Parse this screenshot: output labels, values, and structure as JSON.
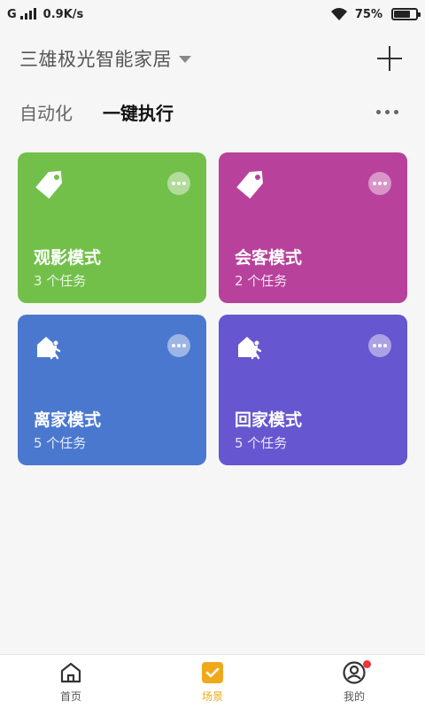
{
  "status_bar": {
    "network_type": "G",
    "speed": "0.9K/s",
    "battery": "75%",
    "battery_level": 0.75
  },
  "header": {
    "home_name": "三雄极光智能家居"
  },
  "tabs": [
    {
      "label": "自动化",
      "active": false
    },
    {
      "label": "一键执行",
      "active": true
    }
  ],
  "scenes": [
    {
      "title": "观影模式",
      "subtitle": "3 个任务",
      "color": "#72c04a",
      "icon": "tag-icon"
    },
    {
      "title": "会客模式",
      "subtitle": "2 个任务",
      "color": "#b8419c",
      "icon": "tag-icon"
    },
    {
      "title": "离家模式",
      "subtitle": "5 个任务",
      "color": "#4a78cf",
      "icon": "leave-home-icon"
    },
    {
      "title": "回家模式",
      "subtitle": "5 个任务",
      "color": "#6656cf",
      "icon": "return-home-icon"
    }
  ],
  "bottom_nav": [
    {
      "label": "首页",
      "icon": "home-icon",
      "active": false
    },
    {
      "label": "场景",
      "icon": "scene-check-icon",
      "active": true
    },
    {
      "label": "我的",
      "icon": "profile-icon",
      "active": false,
      "badge": true
    }
  ],
  "colors": {
    "accent": "#f0a91a",
    "badge": "#e8363a"
  }
}
